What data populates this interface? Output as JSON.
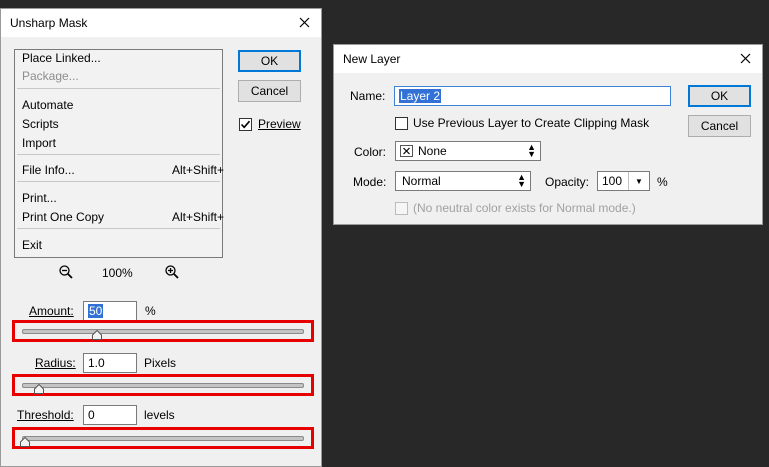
{
  "unsharp": {
    "title": "Unsharp Mask",
    "ok_label": "OK",
    "cancel_label": "Cancel",
    "preview_label": "Preview",
    "preview_checked": true,
    "menu": {
      "items": [
        {
          "label": "Place Linked...",
          "shortcut": "",
          "disabled": false
        },
        {
          "label": "Package...",
          "shortcut": "",
          "disabled": true
        },
        {
          "label": "Automate",
          "shortcut": "",
          "disabled": false
        },
        {
          "label": "Scripts",
          "shortcut": "",
          "disabled": false
        },
        {
          "label": "Import",
          "shortcut": "",
          "disabled": false
        },
        {
          "label": "File Info...",
          "shortcut": "Alt+Shift+",
          "disabled": false
        },
        {
          "label": "Print...",
          "shortcut": "",
          "disabled": false
        },
        {
          "label": "Print One Copy",
          "shortcut": "Alt+Shift+",
          "disabled": false
        },
        {
          "label": "Exit",
          "shortcut": "",
          "disabled": false
        }
      ]
    },
    "zoom_value": "100%",
    "amount": {
      "label": "Amount:",
      "value": "50",
      "unit": "%",
      "slider_fraction": 0.26
    },
    "radius": {
      "label": "Radius:",
      "value": "1.0",
      "unit": "Pixels",
      "slider_fraction": 0.05
    },
    "threshold": {
      "label": "Threshold:",
      "value": "0",
      "unit": "levels",
      "slider_fraction": 0.0
    }
  },
  "new_layer": {
    "title": "New Layer",
    "name_label": "Name:",
    "name_value": "Layer 2",
    "ok_label": "OK",
    "cancel_label": "Cancel",
    "clip_label": "Use Previous Layer to Create Clipping Mask",
    "color_label": "Color:",
    "color_value": "None",
    "mode_label": "Mode:",
    "mode_value": "Normal",
    "opacity_label": "Opacity:",
    "opacity_value": "100",
    "opacity_unit": "%",
    "neutral_label": "(No neutral color exists for Normal mode.)"
  },
  "colors": {
    "highlight_red": "#e60000",
    "selection_blue": "#3272d6",
    "default_button_blue": "#0078d7"
  }
}
